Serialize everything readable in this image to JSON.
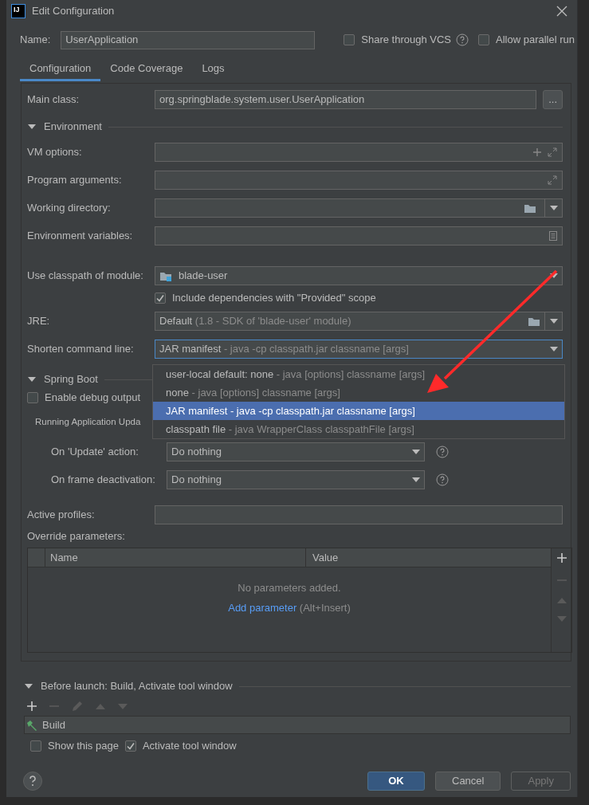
{
  "window": {
    "title": "Edit Configuration",
    "logo_text": "IJ"
  },
  "name_field": {
    "label": "Name:",
    "value": "UserApplication"
  },
  "header_options": [
    {
      "label": "Share through VCS",
      "checked": false,
      "help": true
    },
    {
      "label": "Allow parallel run",
      "checked": false,
      "help": false
    }
  ],
  "tabs": [
    {
      "label": "Configuration",
      "selected": true
    },
    {
      "label": "Code Coverage",
      "selected": false
    },
    {
      "label": "Logs",
      "selected": false
    }
  ],
  "main_class": {
    "label": "Main class:",
    "value": "org.springblade.system.user.UserApplication",
    "browse": "..."
  },
  "environment": {
    "title": "Environment",
    "expanded": true,
    "rows": [
      {
        "label": "VM options:",
        "kind": "options"
      },
      {
        "label": "Program arguments:",
        "kind": "arguments"
      },
      {
        "label": "Working directory:",
        "kind": "directory"
      },
      {
        "label": "Environment variables:",
        "kind": "variables"
      }
    ]
  },
  "module": {
    "label": "Use classpath of module:",
    "value": "blade-user"
  },
  "include_provided": {
    "label": "Include dependencies with \"Provided\" scope",
    "checked": true
  },
  "jre": {
    "label": "JRE:",
    "value": "Default",
    "hint": "(1.8 - SDK of 'blade-user' module)"
  },
  "shorten": {
    "label": "Shorten command line:",
    "value": "JAR manifest",
    "hint": "- java -cp classpath.jar classname [args]",
    "expanded": true,
    "options": [
      {
        "value": "user-local default: none",
        "hint": "- java [options] classname [args]",
        "selected": false
      },
      {
        "value": "none",
        "hint": "- java [options] classname [args]",
        "selected": false
      },
      {
        "value": "JAR manifest",
        "hint": "- java -cp classpath.jar classname [args]",
        "selected": true
      },
      {
        "value": "classpath file",
        "hint": "- java WrapperClass classpathFile [args]",
        "selected": false
      }
    ]
  },
  "spring_boot": {
    "title": "Spring Boot",
    "expanded": true,
    "debug": {
      "label": "Enable debug output",
      "checked": false
    },
    "update_heading": "Running Application Upda",
    "update_rows": [
      {
        "label": "On 'Update' action:",
        "value": "Do nothing"
      },
      {
        "label": "On frame deactivation:",
        "value": "Do nothing"
      }
    ]
  },
  "active_profiles": {
    "label": "Active profiles:"
  },
  "override": {
    "label": "Override parameters:",
    "columns": [
      "Name",
      "Value"
    ],
    "empty_text": "No parameters added.",
    "add_link": "Add parameter",
    "add_shortcut": "(Alt+Insert)"
  },
  "before_launch": {
    "title": "Before launch: Build, Activate tool window",
    "expanded": true,
    "tasks": [
      {
        "label": "Build"
      }
    ]
  },
  "bottom_options": [
    {
      "label": "Show this page",
      "checked": false
    },
    {
      "label": "Activate tool window",
      "checked": true
    }
  ],
  "buttons": [
    {
      "label": "OK",
      "default": true,
      "disabled": false
    },
    {
      "label": "Cancel",
      "default": false,
      "disabled": false
    },
    {
      "label": "Apply",
      "default": false,
      "disabled": true
    }
  ],
  "annotation": {
    "kind": "arrow"
  }
}
